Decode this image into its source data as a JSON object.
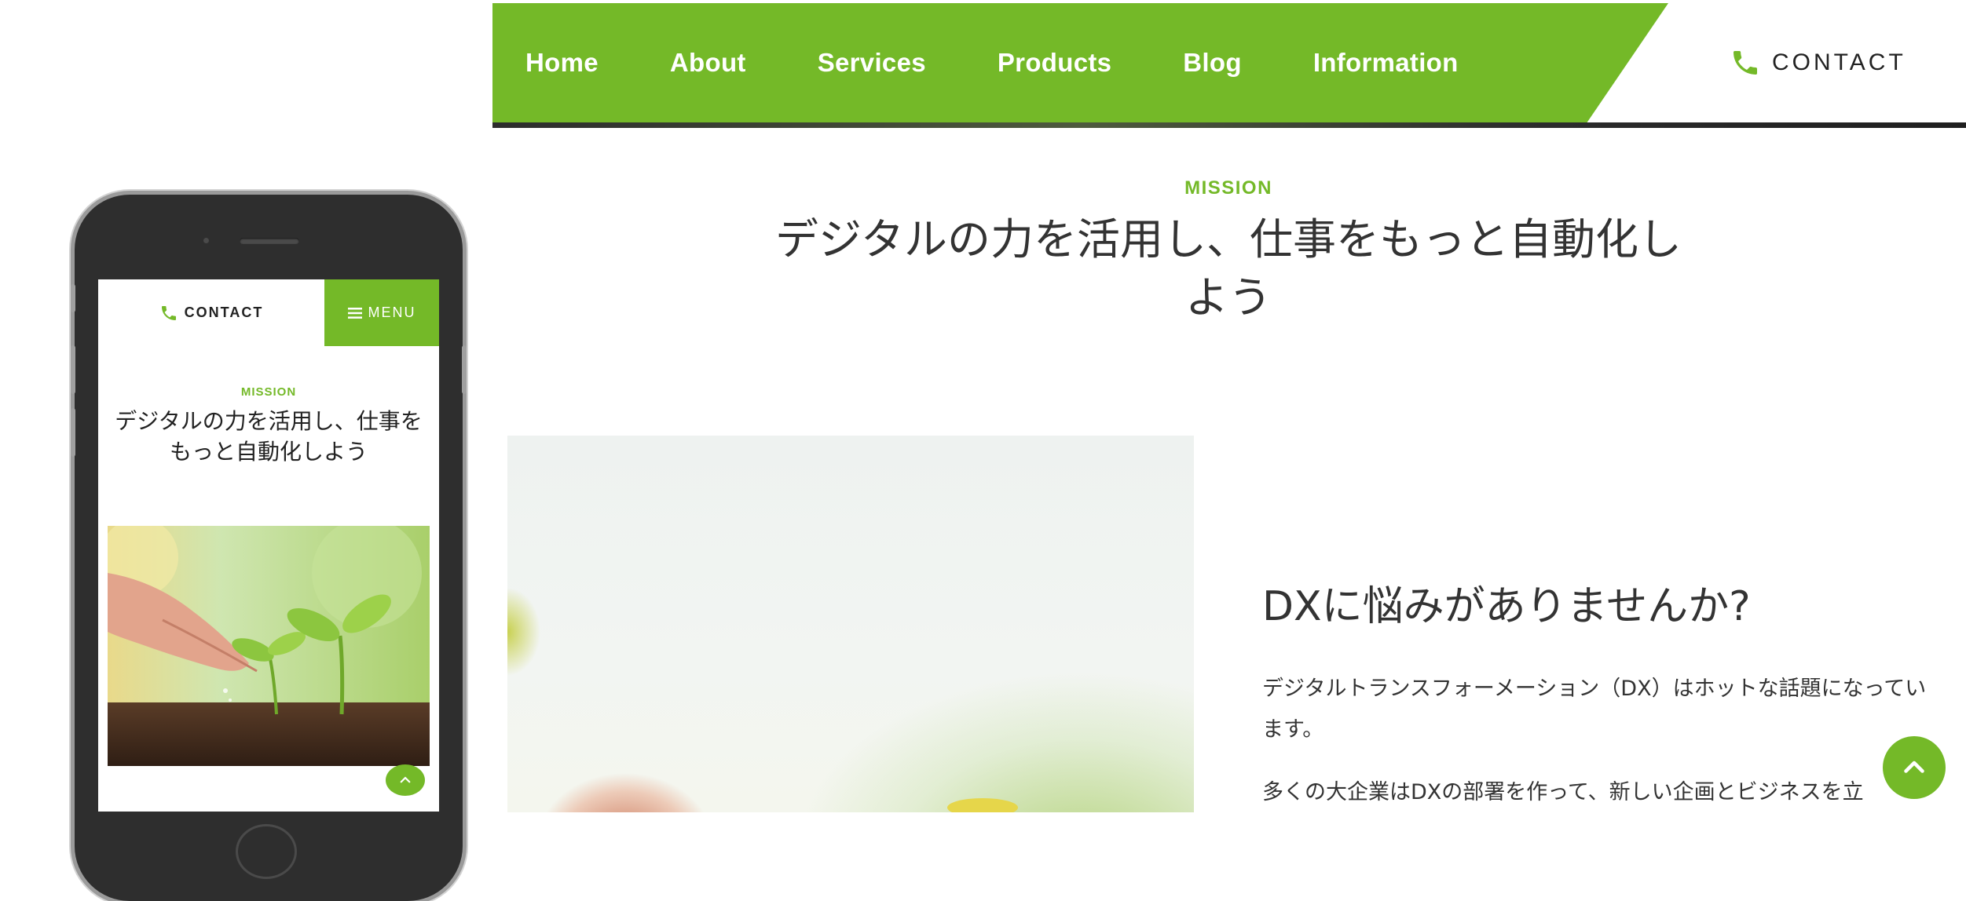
{
  "nav": {
    "items": [
      {
        "label": "Home"
      },
      {
        "label": "About"
      },
      {
        "label": "Services"
      },
      {
        "label": "Products"
      },
      {
        "label": "Blog"
      },
      {
        "label": "Information"
      }
    ],
    "contact_label": "CONTACT"
  },
  "mission": {
    "label": "MISSION",
    "title": "デジタルの力を活用し、仕事をもっと自動化しよう"
  },
  "dx": {
    "title": "DXに悩みがありませんか?",
    "p1": "デジタルトランスフォーメーション（DX）はホットな話題になっています。",
    "p2": "多くの大企業はDXの部署を作って、新しい企画とビジネスを立"
  },
  "mobile": {
    "contact_label": "CONTACT",
    "menu_label": "MENU",
    "mission_label": "MISSION",
    "title": "デジタルの力を活用し、仕事をもっと自動化しよう"
  },
  "colors": {
    "accent": "#74b928",
    "text": "#333333",
    "white": "#ffffff"
  },
  "icons": {
    "phone": "phone-icon",
    "menu": "hamburger-icon",
    "to_top": "chevron-up-icon"
  }
}
